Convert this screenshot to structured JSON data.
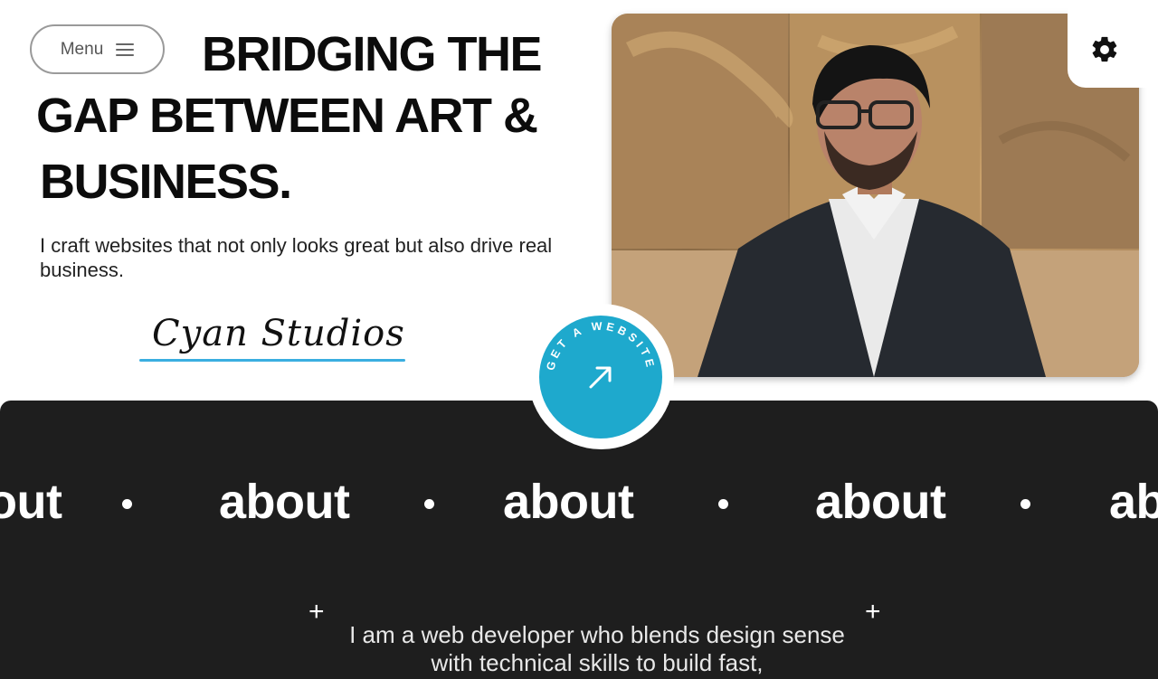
{
  "nav": {
    "menu_label": "Menu"
  },
  "hero": {
    "headline_line1": "BRIDGING THE",
    "headline_line2": "GAP BETWEEN ART &",
    "headline_line3": "BUSINESS.",
    "subtitle": "I craft websites that not only looks great but also drive real business.",
    "signature": "Cyan Studios"
  },
  "cta": {
    "circle_text": "GET A WEBSITE",
    "icon": "arrow-up-right-icon"
  },
  "marquee": {
    "items": [
      "out",
      "about",
      "about",
      "about",
      "ab"
    ]
  },
  "about": {
    "text": "I am a web developer who blends design sense with technical skills to build fast,"
  },
  "colors": {
    "accent": "#1ea9cd",
    "signature_underline": "#3aaee0",
    "dark_bg": "#1e1e1e"
  },
  "icons": {
    "settings": "gear-icon",
    "menu": "hamburger-icon",
    "plus": "plus-icon"
  }
}
